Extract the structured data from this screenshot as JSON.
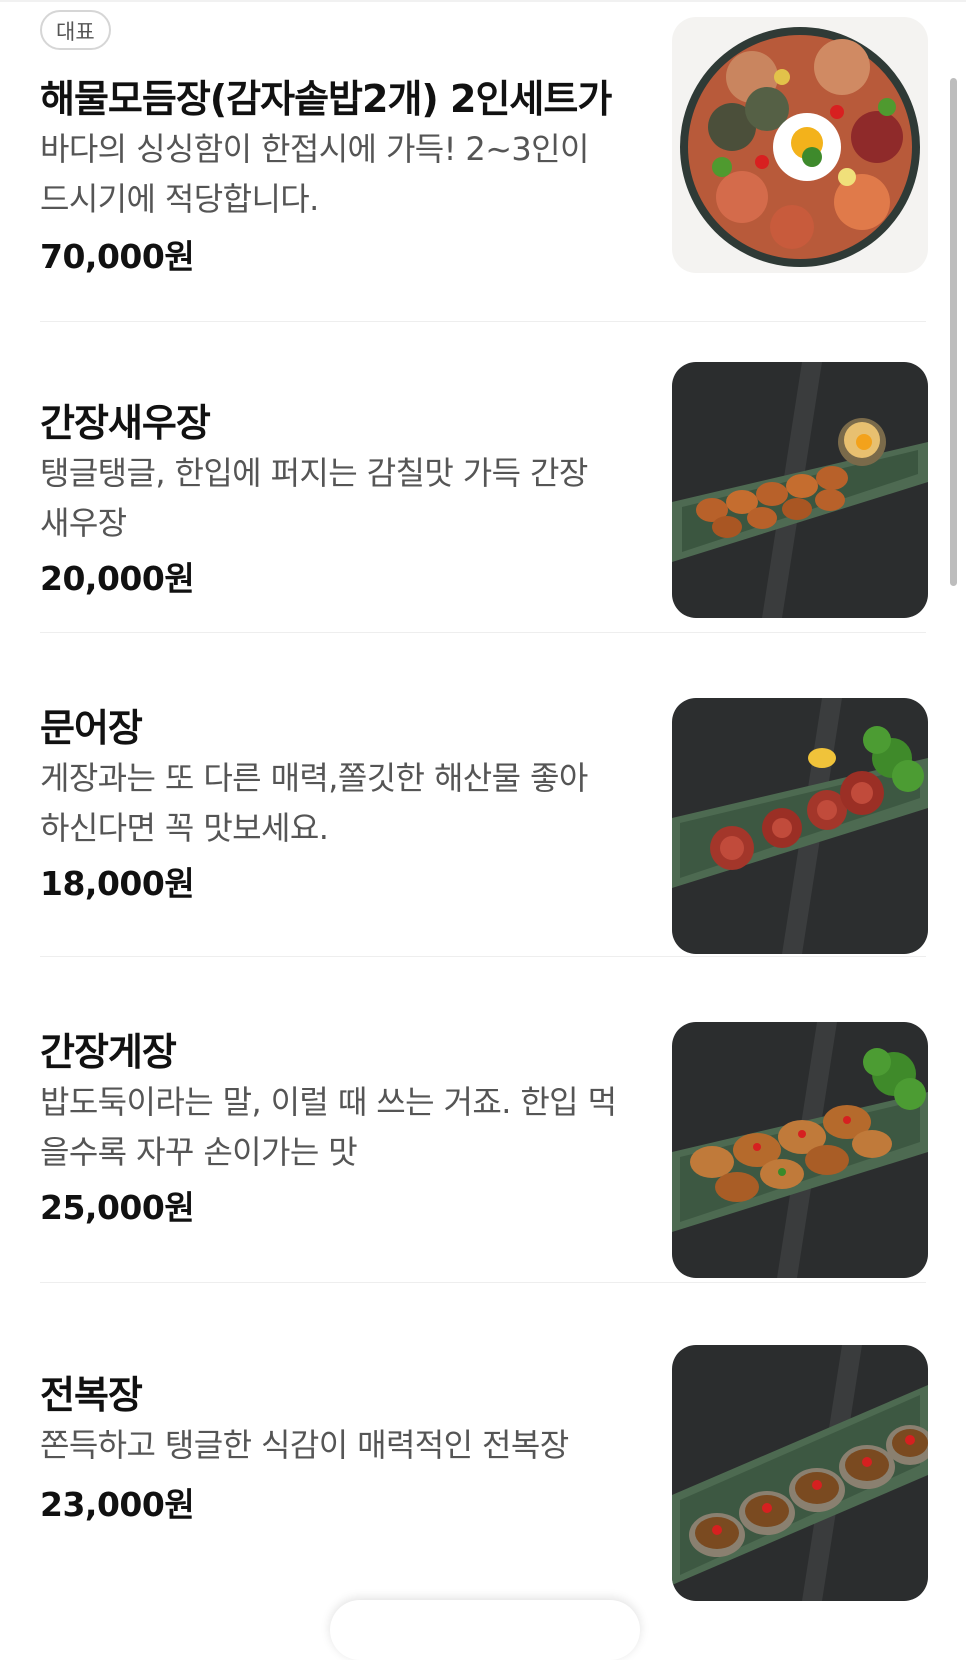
{
  "menu": {
    "items": [
      {
        "badge": "대표",
        "name": "해물모듬장(감자솥밥2개) 2인세트가",
        "desc": "바다의 싱싱함이 한접시에 가득! 2~3인이 드시기에 적당합니다.",
        "price": "70,000원",
        "image_icon": "seafood-platter-photo"
      },
      {
        "name": "간장새우장",
        "desc": "탱글탱글, 한입에 퍼지는 감칠맛 가득 간장 새우장",
        "price": "20,000원",
        "image_icon": "soy-shrimp-photo"
      },
      {
        "name": "문어장",
        "desc": "게장과는 또 다른 매력,쫄깃한 해산물 좋아 하신다면 꼭 맛보세요.",
        "price": "18,000원",
        "image_icon": "octopus-photo"
      },
      {
        "name": "간장게장",
        "desc": "밥도둑이라는 말, 이럴 때 쓰는 거죠. 한입 먹을수록 자꾸 손이가는 맛",
        "price": "25,000원",
        "image_icon": "soy-crab-photo"
      },
      {
        "name": "전복장",
        "desc": "쫀득하고 탱글한 식감이 매력적인 전복장",
        "price": "23,000원",
        "image_icon": "abalone-photo"
      }
    ]
  }
}
